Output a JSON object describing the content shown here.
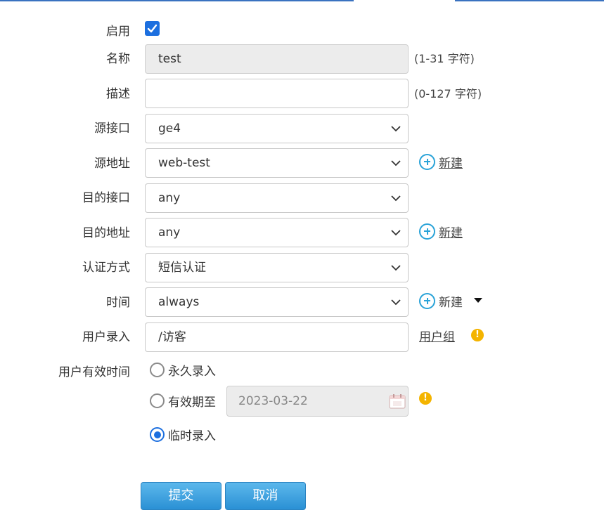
{
  "form": {
    "enable": {
      "label": "启用",
      "checked": true
    },
    "name": {
      "label": "名称",
      "value": "test",
      "hint": "(1-31 字符)"
    },
    "description": {
      "label": "描述",
      "value": "",
      "hint": "(0-127 字符)"
    },
    "source_interface": {
      "label": "源接口",
      "value": "ge4"
    },
    "source_address": {
      "label": "源地址",
      "value": "web-test",
      "new_label": "新建"
    },
    "dest_interface": {
      "label": "目的接口",
      "value": "any"
    },
    "dest_address": {
      "label": "目的地址",
      "value": "any",
      "new_label": "新建"
    },
    "auth_method": {
      "label": "认证方式",
      "value": "短信认证"
    },
    "time": {
      "label": "时间",
      "value": "always",
      "new_label": "新建"
    },
    "user_entry": {
      "label": "用户录入",
      "value": "/访客",
      "group_link": "用户组"
    },
    "validity": {
      "label": "用户有效时间",
      "options": {
        "permanent": "永久录入",
        "until": "有效期至",
        "temporary": "临时录入"
      },
      "selected": "临时录入",
      "date_value": "2023-03-22"
    }
  },
  "buttons": {
    "submit": "提交",
    "cancel": "取消"
  },
  "colors": {
    "accent": "#1c6fdf",
    "button": "#2a90d4",
    "warning": "#f4b400",
    "new_icon": "#2aa3d8"
  }
}
